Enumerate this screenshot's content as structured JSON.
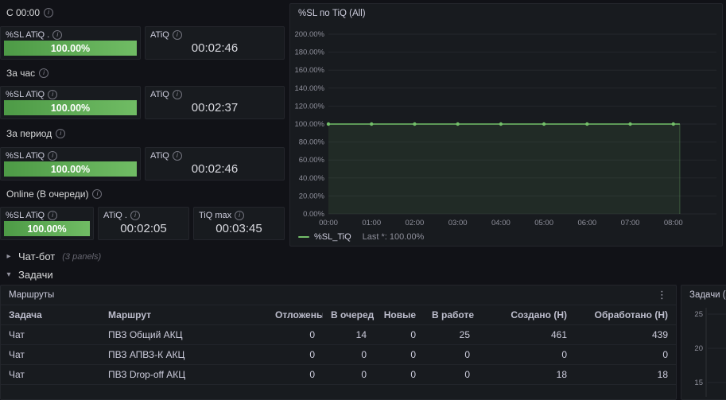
{
  "icons": {
    "info": "i",
    "kebab": "⋮",
    "chevron_collapsed": "▸",
    "chevron_expanded": "▾",
    "sort_desc": "↓"
  },
  "colors": {
    "page_bg": "#111217",
    "panel_bg": "#181b1f",
    "panel_border": "#24262c",
    "text": "#ccccdc",
    "text_dim": "rgba(204,204,220,0.65)",
    "green": "#73bf69",
    "green_area": "rgba(115,191,105,0.10)",
    "grid": "rgba(204,204,220,0.07)"
  },
  "stat_sections": [
    {
      "title": "С 00:00",
      "panels": [
        {
          "title": "%SL ATiQ .",
          "type": "gauge",
          "value": "100.00%"
        },
        {
          "title": "ATiQ",
          "type": "stat",
          "value": "00:02:46"
        }
      ]
    },
    {
      "title": "За час",
      "panels": [
        {
          "title": "%SL ATiQ",
          "type": "gauge",
          "value": "100.00%"
        },
        {
          "title": "ATiQ",
          "type": "stat",
          "value": "00:02:37"
        }
      ]
    },
    {
      "title": "За период",
      "panels": [
        {
          "title": "%SL ATiQ",
          "type": "gauge",
          "value": "100.00%"
        },
        {
          "title": "ATiQ",
          "type": "stat",
          "value": "00:02:46"
        }
      ]
    },
    {
      "title": "Online (В очереди)",
      "panels": [
        {
          "title": "%SL ATiQ",
          "type": "gauge",
          "value": "100.00%"
        },
        {
          "title": "ATiQ .",
          "type": "stat",
          "value": "00:02:05"
        },
        {
          "title": "TiQ max",
          "type": "stat",
          "value": "00:03:45"
        }
      ]
    }
  ],
  "chart_data": {
    "type": "line",
    "title": "%SL по TiQ (All)",
    "x": [
      "00:00",
      "01:00",
      "02:00",
      "03:00",
      "04:00",
      "05:00",
      "06:00",
      "07:00",
      "08:00"
    ],
    "series": [
      {
        "name": "%SL_TiQ",
        "values": [
          100,
          100,
          100,
          100,
          100,
          100,
          100,
          100,
          100
        ],
        "color": "#73bf69"
      }
    ],
    "ylim": [
      0,
      200
    ],
    "ytick_step": 20,
    "ytick_suffix": "%",
    "grid": true,
    "legend_position": "bottom",
    "legend": [
      {
        "label": "%SL_TiQ",
        "detail": "Last *: 100.00%"
      }
    ]
  },
  "rows": {
    "chatbot": {
      "title": "Чат-бот",
      "meta": "(3 panels)",
      "collapsed": true
    },
    "tasks": {
      "title": "Задачи",
      "collapsed": false
    }
  },
  "routes_table": {
    "title": "Маршруты",
    "columns": [
      {
        "label": "Задача",
        "align": "left"
      },
      {
        "label": "Маршрут",
        "align": "left"
      },
      {
        "label": "Отложены",
        "align": "right"
      },
      {
        "label": "В очереди",
        "align": "right",
        "sorted": "desc"
      },
      {
        "label": "Новые",
        "align": "right"
      },
      {
        "label": "В работе",
        "align": "right"
      },
      {
        "label": "Создано (Н)",
        "align": "right"
      },
      {
        "label": "Обработано (Н)",
        "align": "right"
      }
    ],
    "rows": [
      [
        "Чат",
        "ПВЗ Общий АКЦ",
        "0",
        "14",
        "0",
        "25",
        "461",
        "439"
      ],
      [
        "Чат",
        "ПВЗ АПВЗ-К АКЦ",
        "0",
        "0",
        "0",
        "0",
        "0",
        "0"
      ],
      [
        "Чат",
        "ПВЗ Drop-off АКЦ",
        "0",
        "0",
        "0",
        "0",
        "18",
        "18"
      ]
    ]
  },
  "tasks_chart": {
    "title": "Задачи (All",
    "yticks": [
      "25",
      "20",
      "15"
    ]
  }
}
